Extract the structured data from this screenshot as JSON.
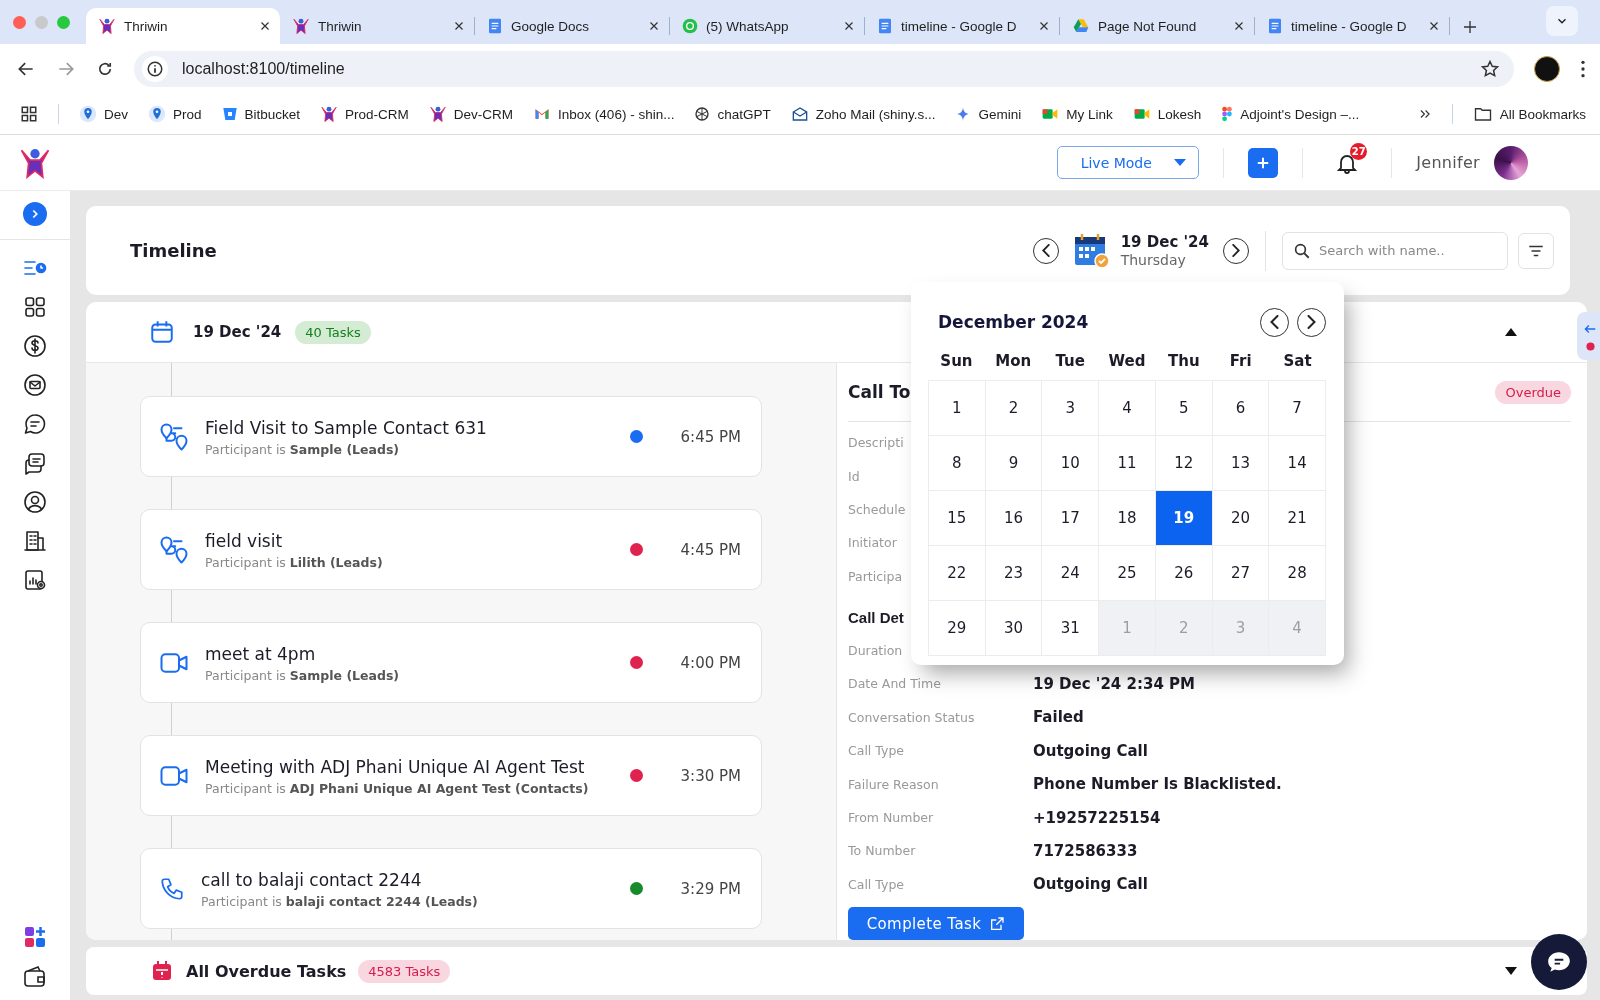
{
  "browser": {
    "tabs": [
      {
        "title": "Thriwin",
        "kind": "thriwin",
        "selected": true
      },
      {
        "title": "Thriwin",
        "kind": "thriwin",
        "selected": false
      },
      {
        "title": "Google Docs",
        "kind": "docs",
        "selected": false
      },
      {
        "title": "(5) WhatsApp",
        "kind": "whatsapp",
        "selected": false
      },
      {
        "title": "timeline - Google D",
        "kind": "docs",
        "selected": false
      },
      {
        "title": "Page Not Found",
        "kind": "drive",
        "selected": false
      },
      {
        "title": "timeline - Google D",
        "kind": "docs",
        "selected": false
      }
    ],
    "url": "localhost:8100/timeline",
    "bookmarks": [
      {
        "label": "Dev",
        "kind": "pin"
      },
      {
        "label": "Prod",
        "kind": "pin"
      },
      {
        "label": "Bitbucket",
        "kind": "bitbucket"
      },
      {
        "label": "Prod-CRM",
        "kind": "thriwin"
      },
      {
        "label": "Dev-CRM",
        "kind": "thriwin"
      },
      {
        "label": "Inbox (406) - shin...",
        "kind": "gmail"
      },
      {
        "label": "chatGPT",
        "kind": "openai"
      },
      {
        "label": "Zoho Mail (shiny.s...",
        "kind": "zoho"
      },
      {
        "label": "Gemini",
        "kind": "gemini"
      },
      {
        "label": "My Link",
        "kind": "meet"
      },
      {
        "label": "Lokesh",
        "kind": "meet"
      },
      {
        "label": "Adjoint's Design –...",
        "kind": "figma"
      }
    ],
    "all_bookmarks": "All Bookmarks"
  },
  "header": {
    "mode": "Live Mode",
    "notifications": "27",
    "user": "Jennifer"
  },
  "sidebar": {
    "items": [
      {
        "kind": "timeline",
        "selected": true
      },
      {
        "kind": "grid",
        "selected": false
      },
      {
        "kind": "dollar",
        "selected": false
      },
      {
        "kind": "mail",
        "selected": false
      },
      {
        "kind": "chat",
        "selected": false
      },
      {
        "kind": "chats",
        "selected": false
      },
      {
        "kind": "user",
        "selected": false
      },
      {
        "kind": "building",
        "selected": false
      },
      {
        "kind": "report",
        "selected": false
      }
    ]
  },
  "timeline": {
    "title": "Timeline",
    "date": "19 Dec '24",
    "weekday": "Thursday",
    "search": {
      "placeholder": "Search with name.."
    }
  },
  "day": {
    "date": "19 Dec '24",
    "count": "40 Tasks",
    "expanded": true,
    "tasks": [
      {
        "kind": "visit",
        "title": "Field Visit to Sample Contact 631",
        "participant": "Participant is **Sample (Leads)**",
        "color": "#1a6cf0",
        "time": "6:45 PM"
      },
      {
        "kind": "visit",
        "title": "field visit",
        "participant": "Participant is **Lilith (Leads)**",
        "color": "#e0234e",
        "time": "4:45 PM"
      },
      {
        "kind": "video",
        "title": "meet at 4pm",
        "participant": "Participant is **Sample (Leads)**",
        "color": "#e0234e",
        "time": "4:00 PM"
      },
      {
        "kind": "video",
        "title": "Meeting with ADJ Phani Unique AI Agent Test",
        "participant": "Participant is **ADJ Phani Unique AI Agent Test (Contacts)**",
        "color": "#e0234e",
        "time": "3:30 PM"
      },
      {
        "kind": "phone",
        "title": "call to balaji contact 2244",
        "participant": "Participant is **balaji contact 2244 (Leads)**",
        "color": "#178a2c",
        "time": "3:29 PM"
      }
    ]
  },
  "detail": {
    "title": "Call To",
    "status": "Overdue",
    "fields": [
      {
        "label": "Descripti"
      },
      {
        "label": "Id"
      },
      {
        "label": "Schedule"
      },
      {
        "label": "Initiator"
      },
      {
        "label": "Participa"
      }
    ],
    "section": "Call Det",
    "call_fields": [
      {
        "label": "Duration"
      },
      {
        "label": "Date And Time",
        "value": "19 Dec '24 2:34 PM"
      },
      {
        "label": "Conversation Status",
        "value": "Failed"
      },
      {
        "label": "Call Type",
        "value": "Outgoing Call"
      },
      {
        "label": "Failure Reason",
        "value": "Phone Number Is Blacklisted."
      },
      {
        "label": "From Number",
        "value": "+19257225154"
      },
      {
        "label": "To Number",
        "value": "7172586333"
      },
      {
        "label": "Call Type",
        "value": "Outgoing Call"
      }
    ],
    "action": "Complete Task"
  },
  "calendar": {
    "month": "December 2024",
    "weekdays": [
      "Sun",
      "Mon",
      "Tue",
      "Wed",
      "Thu",
      "Fri",
      "Sat"
    ],
    "days": [
      {
        "label": "1",
        "selected": false,
        "disabled": false
      },
      {
        "label": "2",
        "selected": false,
        "disabled": false
      },
      {
        "label": "3",
        "selected": false,
        "disabled": false
      },
      {
        "label": "4",
        "selected": false,
        "disabled": false
      },
      {
        "label": "5",
        "selected": false,
        "disabled": false
      },
      {
        "label": "6",
        "selected": false,
        "disabled": false
      },
      {
        "label": "7",
        "selected": false,
        "disabled": false
      },
      {
        "label": "8",
        "selected": false,
        "disabled": false
      },
      {
        "label": "9",
        "selected": false,
        "disabled": false
      },
      {
        "label": "10",
        "selected": false,
        "disabled": false
      },
      {
        "label": "11",
        "selected": false,
        "disabled": false
      },
      {
        "label": "12",
        "selected": false,
        "disabled": false
      },
      {
        "label": "13",
        "selected": false,
        "disabled": false
      },
      {
        "label": "14",
        "selected": false,
        "disabled": false
      },
      {
        "label": "15",
        "selected": false,
        "disabled": false
      },
      {
        "label": "16",
        "selected": false,
        "disabled": false
      },
      {
        "label": "17",
        "selected": false,
        "disabled": false
      },
      {
        "label": "18",
        "selected": false,
        "disabled": false
      },
      {
        "label": "19",
        "selected": true,
        "disabled": false
      },
      {
        "label": "20",
        "selected": false,
        "disabled": false
      },
      {
        "label": "21",
        "selected": false,
        "disabled": false
      },
      {
        "label": "22",
        "selected": false,
        "disabled": false
      },
      {
        "label": "23",
        "selected": false,
        "disabled": false
      },
      {
        "label": "24",
        "selected": false,
        "disabled": false
      },
      {
        "label": "25",
        "selected": false,
        "disabled": false
      },
      {
        "label": "26",
        "selected": false,
        "disabled": false
      },
      {
        "label": "27",
        "selected": false,
        "disabled": false
      },
      {
        "label": "28",
        "selected": false,
        "disabled": false
      },
      {
        "label": "29",
        "selected": false,
        "disabled": false
      },
      {
        "label": "30",
        "selected": false,
        "disabled": false
      },
      {
        "label": "31",
        "selected": false,
        "disabled": false
      },
      {
        "label": "1",
        "selected": false,
        "disabled": true
      },
      {
        "label": "2",
        "selected": false,
        "disabled": true
      },
      {
        "label": "3",
        "selected": false,
        "disabled": true
      },
      {
        "label": "4",
        "selected": false,
        "disabled": true
      }
    ]
  },
  "overdue": {
    "title": "All Overdue Tasks",
    "count": "4583 Tasks",
    "expanded": false
  }
}
